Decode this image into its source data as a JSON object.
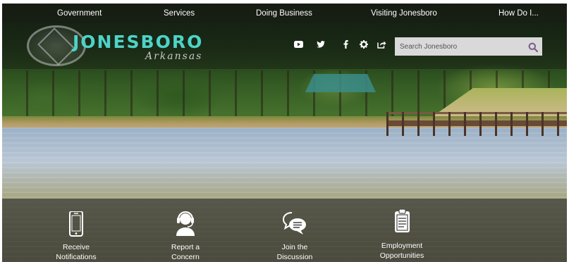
{
  "nav": {
    "items": [
      {
        "label": "Government"
      },
      {
        "label": "Services"
      },
      {
        "label": "Doing Business"
      },
      {
        "label": "Visiting Jonesboro"
      },
      {
        "label": "How Do I..."
      }
    ]
  },
  "header": {
    "brand": "JONESBORO",
    "brand_sub": "Arkansas",
    "social_icons": [
      "youtube-icon",
      "twitter-icon",
      "facebook-icon",
      "gear-icon",
      "share-icon"
    ],
    "search": {
      "placeholder": "Search Jonesboro"
    }
  },
  "quick_links": [
    {
      "line1": "Receive",
      "line2": "Notifications",
      "icon": "phone-icon"
    },
    {
      "line1": "Report a",
      "line2": "Concern",
      "icon": "headset-icon"
    },
    {
      "line1": "Join the",
      "line2": "Discussion",
      "icon": "chat-icon"
    },
    {
      "line1": "Employment",
      "line2": "Opportunities",
      "icon": "clipboard-icon"
    }
  ],
  "colors": {
    "brand": "#4ed3c8",
    "nav_bg": "#181c14",
    "search_bg": "#d9d9d9",
    "search_icon": "#7a5a8a"
  }
}
